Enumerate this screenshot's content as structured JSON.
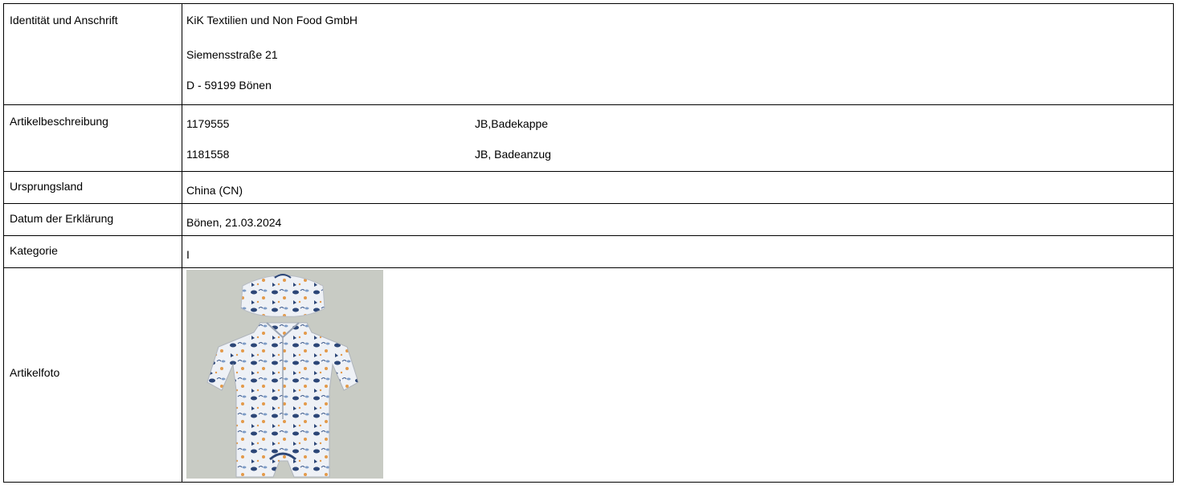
{
  "rows": {
    "identity": {
      "label": "Identität und Anschrift",
      "lines": [
        "KiK Textilien und Non Food GmbH",
        "Siemensstraße 21",
        "D - 59199 Bönen"
      ]
    },
    "articles": {
      "label": "Artikelbeschreibung",
      "items": [
        {
          "number": "1179555",
          "description": "JB,Badekappe"
        },
        {
          "number": "1181558",
          "description": "JB, Badeanzug"
        }
      ]
    },
    "origin": {
      "label": "Ursprungsland",
      "value": "China (CN)"
    },
    "date": {
      "label": "Datum der Erklärung",
      "value": "Bönen, 21.03.2024"
    },
    "category": {
      "label": "Kategorie",
      "value": "I"
    },
    "photo": {
      "label": "Artikelfoto",
      "image_subject": "swim-cap-and-swimsuit-photo"
    }
  }
}
